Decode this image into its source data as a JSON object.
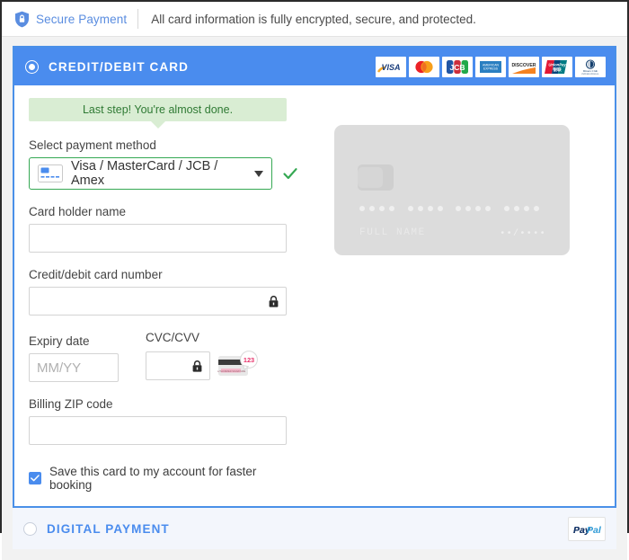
{
  "secure_bar": {
    "icon": "shield-lock-icon",
    "label": "Secure Payment",
    "note": "All card information is fully encrypted, secure, and protected."
  },
  "card_method": {
    "selected": true,
    "title": "CREDIT/DEBIT CARD",
    "brands": [
      {
        "name": "visa-logo",
        "text": "VISA"
      },
      {
        "name": "mastercard-logo",
        "text": "Mastercard"
      },
      {
        "name": "jcb-logo",
        "text": "JCB"
      },
      {
        "name": "amex-logo",
        "text": "AMERICAN EXPRESS"
      },
      {
        "name": "discover-logo",
        "text": "DISCOVER"
      },
      {
        "name": "unionpay-logo",
        "text": "UnionPay"
      },
      {
        "name": "diners-club-logo",
        "text": "Diners Club INTERNATIONAL"
      }
    ],
    "tooltip": "Last step! You're almost done.",
    "payment_method": {
      "label": "Select payment method",
      "value": "Visa / MasterCard / JCB / Amex",
      "valid": true
    },
    "holder_name": {
      "label": "Card holder name",
      "value": "",
      "placeholder": ""
    },
    "card_number": {
      "label": "Credit/debit card number",
      "value": "",
      "placeholder": "",
      "icon": "lock-icon"
    },
    "expiry": {
      "label": "Expiry date",
      "value": "",
      "placeholder": "MM/YY"
    },
    "cvc": {
      "label": "CVC/CVV",
      "value": "",
      "placeholder": "",
      "icon": "lock-icon",
      "hint_icon": "card-back-cvv-icon",
      "hint_digits": "123"
    },
    "zip": {
      "label": "Billing ZIP code",
      "value": "",
      "placeholder": ""
    },
    "save_card": {
      "checked": true,
      "label": "Save this card to my account for faster booking"
    },
    "preview": {
      "name_placeholder": "FULL NAME",
      "expiry_placeholder": "••/••••"
    }
  },
  "digital_method": {
    "selected": false,
    "title": "DIGITAL PAYMENT",
    "logo": "paypal-logo",
    "logo_text": "PayPal"
  },
  "colors": {
    "brand_blue": "#4a8cee",
    "success_green": "#35a853",
    "tooltip_bg": "#d9edd3",
    "tooltip_text": "#2f7a34",
    "panel_bg": "#f2f2f2",
    "digital_bg": "#f3f6fc"
  }
}
